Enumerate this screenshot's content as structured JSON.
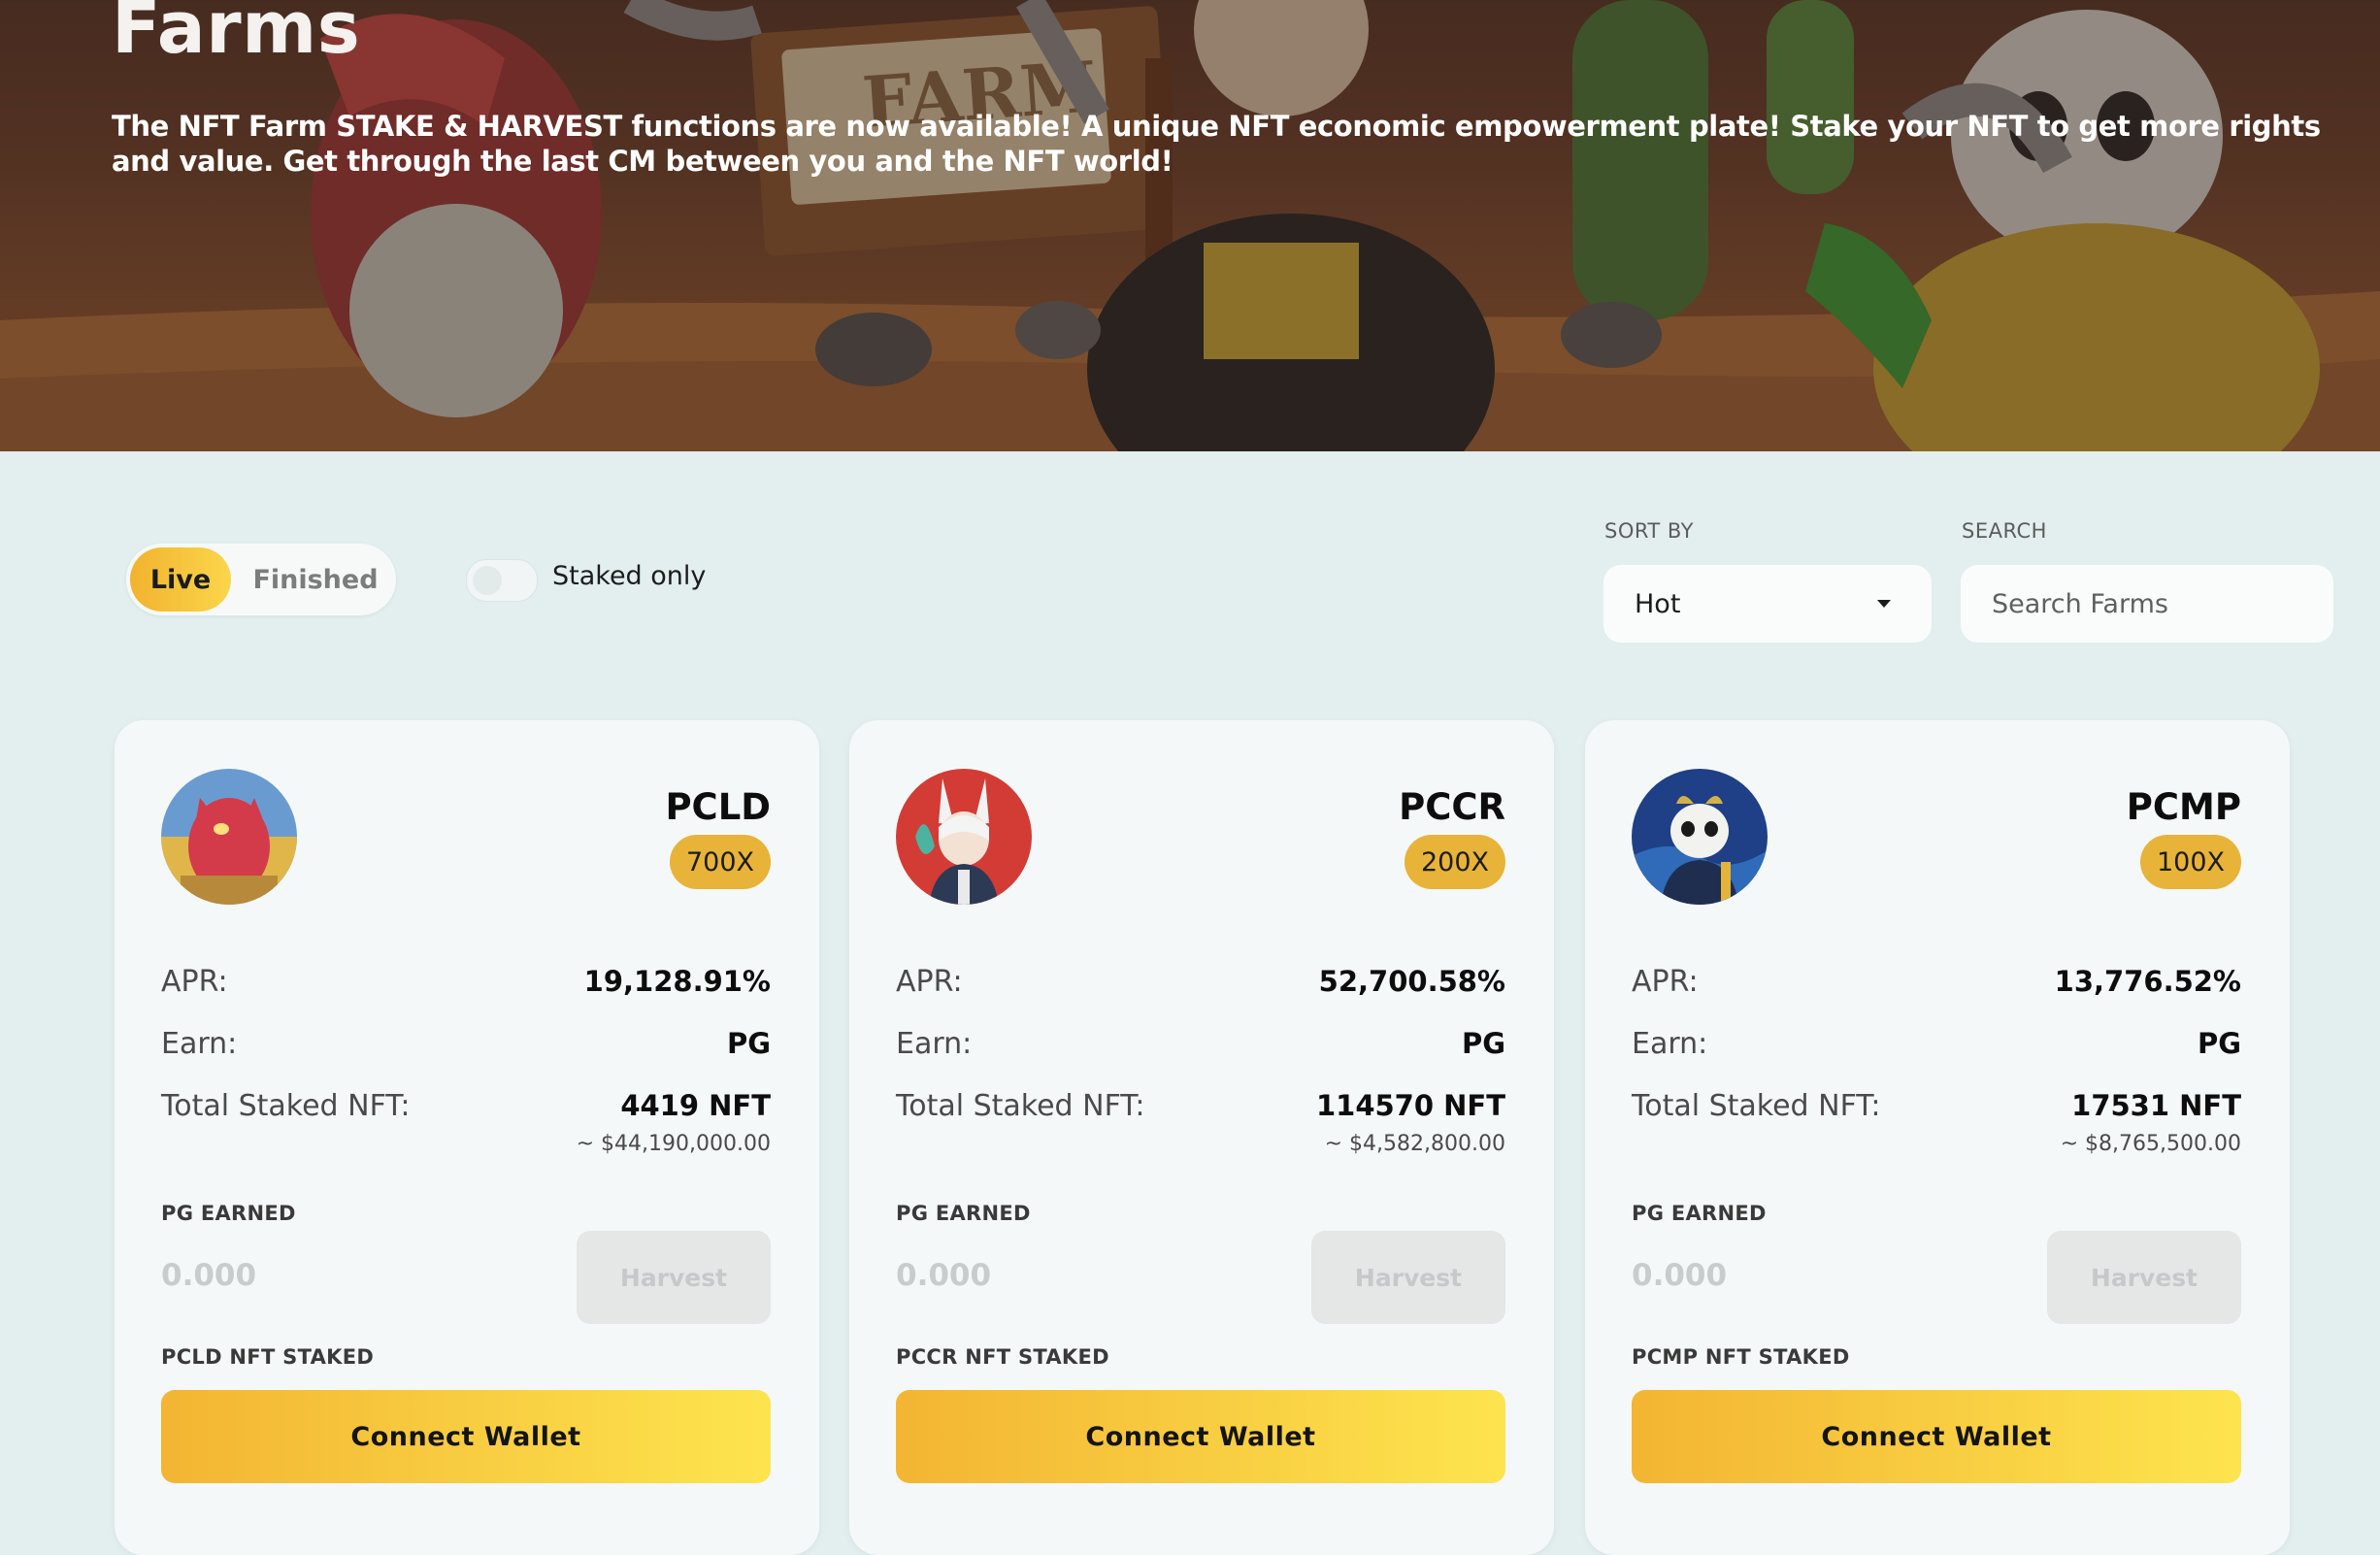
{
  "hero": {
    "title": "Farms",
    "description": "The NFT Farm STAKE & HARVEST functions are now available! A unique NFT economic empowerment plate! Stake your NFT to get more rights and value. Get through the last CM between you and the NFT world!",
    "sign_text": "FARM"
  },
  "filters": {
    "tab_live": "Live",
    "tab_finished": "Finished",
    "staked_only_label": "Staked only",
    "staked_only_on": false,
    "sort_by_label": "SORT BY",
    "sort_value": "Hot",
    "search_label": "SEARCH",
    "search_placeholder": "Search Farms"
  },
  "colors": {
    "accent_start": "#f2b32f",
    "accent_end": "#fde44e",
    "multiplier_badge": "#e8b339",
    "page_background": "#e3eeee"
  },
  "farms": [
    {
      "ticker": "PCLD",
      "multiplier": "700X",
      "apr_label": "APR:",
      "apr": "19,128.91%",
      "earn_label": "Earn:",
      "earn": "PG",
      "staked_label": "Total Staked NFT:",
      "staked": "4419 NFT",
      "staked_usd": "~ $44,190,000.00",
      "earned_label": "PG EARNED",
      "earned": "0.000",
      "harvest_label": "Harvest",
      "nft_staked_label": "PCLD NFT STAKED",
      "connect_label": "Connect Wallet",
      "avatar_icon": "red-dragon-avatar-icon"
    },
    {
      "ticker": "PCCR",
      "multiplier": "200X",
      "apr_label": "APR:",
      "apr": "52,700.58%",
      "earn_label": "Earn:",
      "earn": "PG",
      "staked_label": "Total Staked NFT:",
      "staked": "114570 NFT",
      "staked_usd": "~ $4,582,800.00",
      "earned_label": "PG EARNED",
      "earned": "0.000",
      "harvest_label": "Harvest",
      "nft_staked_label": "PCCR NFT STAKED",
      "connect_label": "Connect Wallet",
      "avatar_icon": "rabbit-warrior-avatar-icon"
    },
    {
      "ticker": "PCMP",
      "multiplier": "100X",
      "apr_label": "APR:",
      "apr": "13,776.52%",
      "earn_label": "Earn:",
      "earn": "PG",
      "staked_label": "Total Staked NFT:",
      "staked": "17531 NFT",
      "staked_usd": "~ $8,765,500.00",
      "earned_label": "PG EARNED",
      "earned": "0.000",
      "harvest_label": "Harvest",
      "nft_staked_label": "PCMP NFT STAKED",
      "connect_label": "Connect Wallet",
      "avatar_icon": "panda-avatar-icon"
    }
  ]
}
